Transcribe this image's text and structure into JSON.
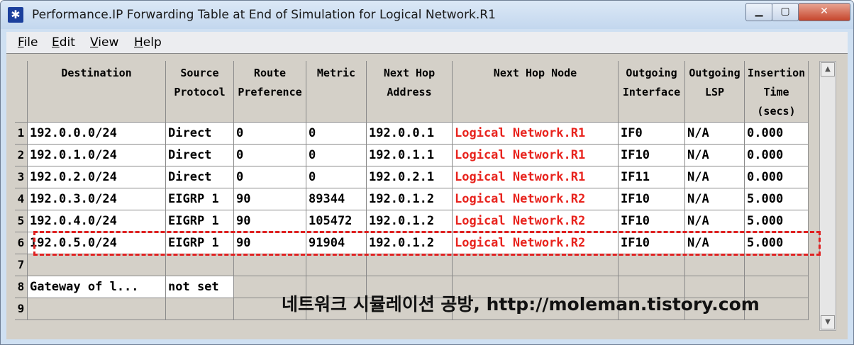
{
  "window": {
    "title": "Performance.IP Forwarding Table at End of Simulation for Logical Network.R1",
    "icon": "app-star-icon",
    "buttons": {
      "minimize": "minimize-icon",
      "maximize": "maximize-icon",
      "close": "close-icon"
    }
  },
  "menu": [
    {
      "label_ul": "F",
      "label_rest": "ile"
    },
    {
      "label_ul": "E",
      "label_rest": "dit"
    },
    {
      "label_ul": "V",
      "label_rest": "iew"
    },
    {
      "label_ul": "H",
      "label_rest": "elp"
    }
  ],
  "table": {
    "headers": [
      [
        "Destination"
      ],
      [
        "Source",
        "Protocol"
      ],
      [
        "Route",
        "Preference"
      ],
      [
        "Metric"
      ],
      [
        "Next Hop",
        "Address"
      ],
      [
        "Next Hop Node"
      ],
      [
        "Outgoing",
        "Interface"
      ],
      [
        "Outgoing",
        "LSP"
      ],
      [
        "Insertion",
        "Time",
        "(secs)"
      ]
    ],
    "rows": [
      {
        "num": "1",
        "cells": [
          "192.0.0.0/24",
          "Direct",
          "0",
          "0",
          "192.0.0.1",
          "Logical Network.R1",
          "IF0",
          "N/A",
          "0.000"
        ]
      },
      {
        "num": "2",
        "cells": [
          "192.0.1.0/24",
          "Direct",
          "0",
          "0",
          "192.0.1.1",
          "Logical Network.R1",
          "IF10",
          "N/A",
          "0.000"
        ]
      },
      {
        "num": "3",
        "cells": [
          "192.0.2.0/24",
          "Direct",
          "0",
          "0",
          "192.0.2.1",
          "Logical Network.R1",
          "IF11",
          "N/A",
          "0.000"
        ]
      },
      {
        "num": "4",
        "cells": [
          "192.0.3.0/24",
          "EIGRP 1",
          "90",
          "89344",
          "192.0.1.2",
          "Logical Network.R2",
          "IF10",
          "N/A",
          "5.000"
        ]
      },
      {
        "num": "5",
        "cells": [
          "192.0.4.0/24",
          "EIGRP 1",
          "90",
          "105472",
          "192.0.1.2",
          "Logical Network.R2",
          "IF10",
          "N/A",
          "5.000"
        ]
      },
      {
        "num": "6",
        "cells": [
          "192.0.5.0/24",
          "EIGRP 1",
          "90",
          "91904",
          "192.0.1.2",
          "Logical Network.R2",
          "IF10",
          "N/A",
          "5.000"
        ]
      },
      {
        "num": "7",
        "cells": [
          "",
          "",
          "",
          "",
          "",
          "",
          "",
          "",
          ""
        ]
      },
      {
        "num": "8",
        "cells": [
          "Gateway of l...",
          "not set",
          "",
          "",
          "",
          "",
          "",
          "",
          ""
        ]
      },
      {
        "num": "9",
        "cells": [
          "",
          "",
          "",
          "",
          "",
          "",
          "",
          "",
          ""
        ]
      }
    ]
  },
  "watermark": "네트워크 시뮬레이션 공방, http://moleman.tistory.com",
  "colors": {
    "node_text": "#e8231d",
    "highlight": "#e02020"
  }
}
